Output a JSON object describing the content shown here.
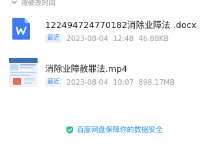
{
  "sort": {
    "label": "按修改时间"
  },
  "files": [
    {
      "name": "122494724770182消除业障法 .docx",
      "badge": "最近",
      "date": "2023-08-04",
      "time": "12:48",
      "size": "46.88KB",
      "icon": "word-doc-icon"
    },
    {
      "name": "消除业障赦罪法.mp4",
      "badge": "最近",
      "date": "2023-08-04",
      "time": "10:07",
      "size": "898.17MB",
      "icon": "video-thumbnail"
    }
  ],
  "footer": {
    "label": "百度网盘保障你的数据安全",
    "color": "#2b8ff0"
  },
  "colors": {
    "word": "#3d7cf0",
    "badge_bg": "#eaf3fd",
    "badge_fg": "#4a8fe0"
  }
}
